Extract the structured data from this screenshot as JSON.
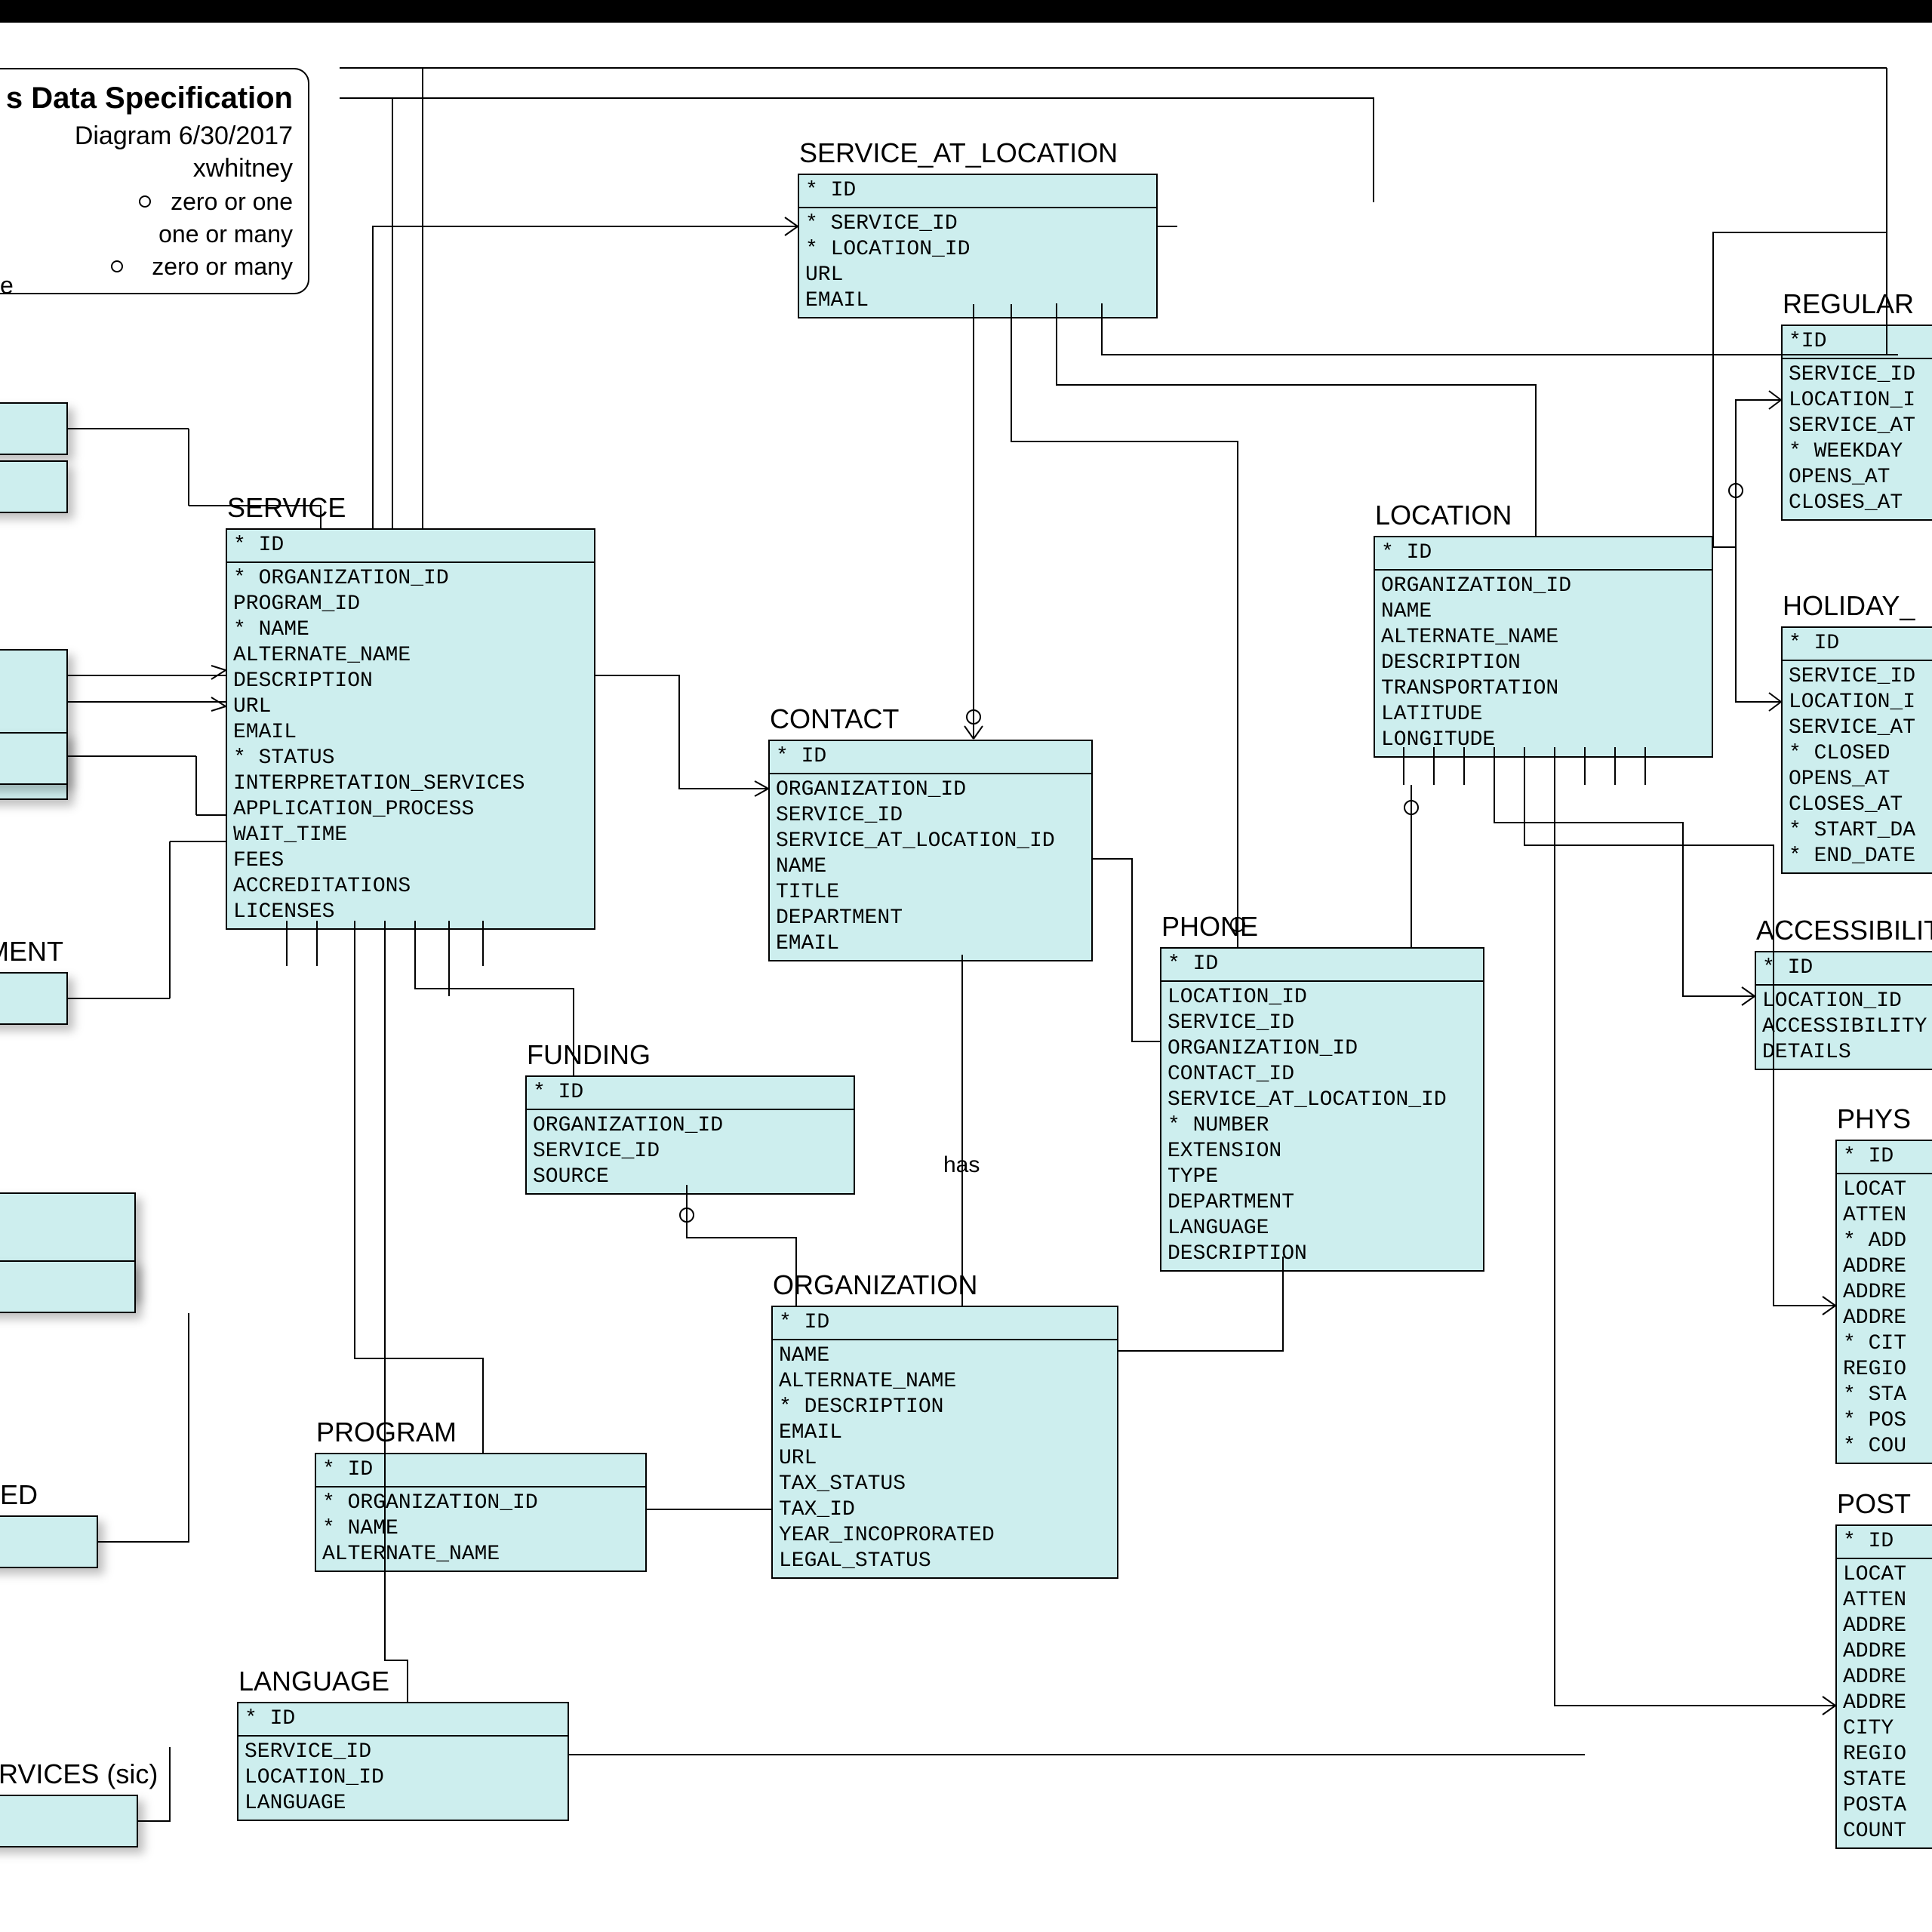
{
  "title": {
    "line1_suffix": "s Data Specification",
    "line2": "Diagram 6/30/2017",
    "line3_suffix": "xwhitney"
  },
  "legend": [
    {
      "label": "zero or one"
    },
    {
      "label": "one or many"
    },
    {
      "label": "zero or many"
    }
  ],
  "rel_labels": {
    "has": "has"
  },
  "left_fragments": {
    "cument": "CUMENT",
    "epted": "EPTED",
    "services": "_SERVICES (sic)",
    "partial_e": "e"
  },
  "entities": {
    "service_at_location": {
      "title": "SERVICE_AT_LOCATION",
      "pk": "* ID",
      "fields": [
        "* SERVICE_ID",
        "* LOCATION_ID",
        "URL",
        "EMAIL"
      ]
    },
    "service": {
      "title": "SERVICE",
      "pk": "* ID",
      "fields": [
        "* ORGANIZATION_ID",
        "PROGRAM_ID",
        "* NAME",
        "ALTERNATE_NAME",
        "DESCRIPTION",
        "URL",
        "EMAIL",
        "* STATUS",
        "INTERPRETATION_SERVICES",
        "APPLICATION_PROCESS",
        "WAIT_TIME",
        "FEES",
        "ACCREDITATIONS",
        "LICENSES"
      ]
    },
    "contact": {
      "title": "CONTACT",
      "pk": "* ID",
      "fields": [
        "ORGANIZATION_ID",
        "SERVICE_ID",
        "SERVICE_AT_LOCATION_ID",
        "NAME",
        "TITLE",
        "DEPARTMENT",
        "EMAIL"
      ]
    },
    "location": {
      "title": "LOCATION",
      "pk": "* ID",
      "fields": [
        "ORGANIZATION_ID",
        "NAME",
        "ALTERNATE_NAME",
        "DESCRIPTION",
        "TRANSPORTATION",
        "LATITUDE",
        "LONGITUDE"
      ]
    },
    "regular": {
      "title": "REGULAR",
      "pk": "*ID",
      "fields": [
        "SERVICE_ID",
        "LOCATION_I",
        "SERVICE_AT",
        "* WEEKDAY",
        "OPENS_AT",
        "CLOSES_AT"
      ]
    },
    "holiday": {
      "title": "HOLIDAY_",
      "pk": "* ID",
      "fields": [
        "SERVICE_ID",
        "LOCATION_I",
        "SERVICE_AT",
        "* CLOSED",
        "OPENS_AT",
        "CLOSES_AT",
        "* START_DA",
        "* END_DATE"
      ]
    },
    "accessibility": {
      "title": "ACCESSIBILITY_",
      "pk": "* ID",
      "fields": [
        "LOCATION_ID",
        "ACCESSIBILITY",
        "DETAILS"
      ]
    },
    "physical": {
      "title": "PHYS",
      "pk": "* ID",
      "fields": [
        "LOCAT",
        "ATTEN",
        "* ADD",
        "ADDRE",
        "ADDRE",
        "ADDRE",
        "* CIT",
        "REGIO",
        "* STA",
        "* POS",
        "* COU"
      ]
    },
    "postal": {
      "title": "POST",
      "pk": "* ID",
      "fields": [
        "LOCAT",
        "ATTEN",
        "ADDRE",
        "ADDRE",
        "ADDRE",
        "ADDRE",
        "CITY",
        "REGIO",
        "STATE",
        "POSTA",
        "COUNT"
      ]
    },
    "phone": {
      "title": "PHONE",
      "pk": "* ID",
      "fields": [
        "LOCATION_ID",
        "SERVICE_ID",
        "ORGANIZATION_ID",
        "CONTACT_ID",
        "SERVICE_AT_LOCATION_ID",
        "* NUMBER",
        "EXTENSION",
        "TYPE",
        "DEPARTMENT",
        "LANGUAGE",
        "DESCRIPTION"
      ]
    },
    "funding": {
      "title": "FUNDING",
      "pk": "* ID",
      "fields": [
        "ORGANIZATION_ID",
        "SERVICE_ID",
        "SOURCE"
      ]
    },
    "organization": {
      "title": "ORGANIZATION",
      "pk": "* ID",
      "fields": [
        "NAME",
        "ALTERNATE_NAME",
        "* DESCRIPTION",
        "EMAIL",
        "URL",
        "TAX_STATUS",
        "TAX_ID",
        "YEAR_INCOPRORATED",
        "LEGAL_STATUS"
      ]
    },
    "program": {
      "title": "PROGRAM",
      "pk": "* ID",
      "fields": [
        "* ORGANIZATION_ID",
        "* NAME",
        "ALTERNATE_NAME"
      ]
    },
    "language": {
      "title": "LANGUAGE",
      "pk": "* ID",
      "fields": [
        "SERVICE_ID",
        "LOCATION_ID",
        "LANGUAGE"
      ]
    }
  }
}
